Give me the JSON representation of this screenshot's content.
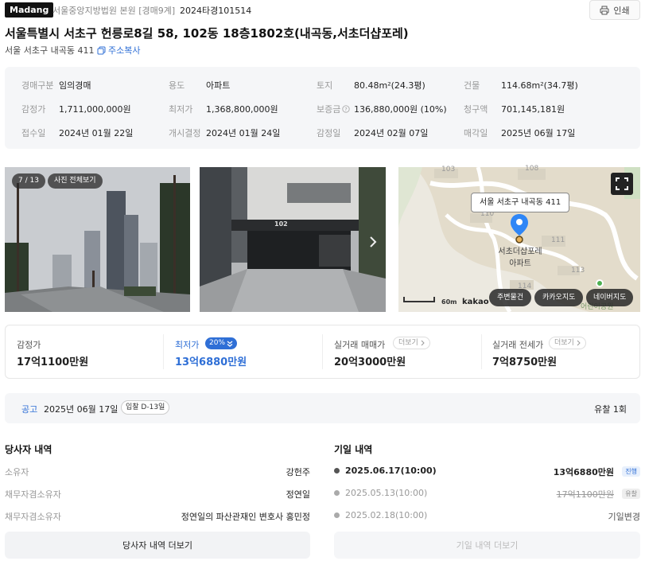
{
  "header": {
    "logo": "Madang",
    "court": "서울중앙지방법원 본원 [경매9계]",
    "case_no": "2024타경101514",
    "print_label": "인쇄"
  },
  "property": {
    "title": "서울특별시 서초구 헌릉로8길 58, 102동 18층1802호(내곡동,서초더샵포레)",
    "sub_address": "서울 서초구 내곡동 411",
    "copy_label": "주소복사"
  },
  "info": {
    "r1": [
      {
        "label": "경매구분",
        "value": "임의경매"
      },
      {
        "label": "용도",
        "value": "아파트"
      },
      {
        "label": "토지",
        "value": "80.48m²(24.3평)"
      },
      {
        "label": "건물",
        "value": "114.68m²(34.7평)"
      }
    ],
    "r2": [
      {
        "label": "감정가",
        "value": "1,711,000,000원"
      },
      {
        "label": "최저가",
        "value": "1,368,800,000원"
      },
      {
        "label": "보증금",
        "value": "136,880,000원 (10%)"
      },
      {
        "label": "청구액",
        "value": "701,145,181원"
      }
    ],
    "r3": [
      {
        "label": "접수일",
        "value": "2024년 01월 22일"
      },
      {
        "label": "개시결정",
        "value": "2024년 01월 24일"
      },
      {
        "label": "감정일",
        "value": "2024년 02월 07일"
      },
      {
        "label": "매각일",
        "value": "2025년 06월 17일"
      }
    ]
  },
  "gallery": {
    "counter": "7 / 13",
    "view_all": "사진 전체보기",
    "building_sign": "102"
  },
  "map": {
    "popup": "서울 서초구 내곡동 411",
    "complex_label_1": "서초더샵포레",
    "complex_label_2": "아파트",
    "bldg_labels": [
      "103",
      "108",
      "110",
      "111",
      "113",
      "114"
    ],
    "park_label": "어린이공원",
    "scale": "60m",
    "brand": "kakao",
    "btn_around": "주변물건",
    "btn_kakao": "카카오지도",
    "btn_naver": "네이버지도"
  },
  "prices": {
    "appraisal": {
      "label": "감정가",
      "value": "17억1100만원"
    },
    "minimum": {
      "label": "최저가",
      "badge": "20%",
      "value": "13억6880만원"
    },
    "sale": {
      "label": "실거래 매매가",
      "more": "더보기",
      "value": "20억3000만원"
    },
    "rent": {
      "label": "실거래 전세가",
      "more": "더보기",
      "value": "7억8750만원"
    }
  },
  "notice": {
    "label": "공고",
    "date": "2025년 06월 17일",
    "dday": "입찰 D-13일",
    "failed": "유찰 1회"
  },
  "parties": {
    "title": "당사자 내역",
    "rows": [
      {
        "role": "소유자",
        "name": "강헌주"
      },
      {
        "role": "채무자겸소유자",
        "name": "정연일"
      },
      {
        "role": "채무자겸소유자",
        "name": "정연일의 파산관재인 변호사 홍민정"
      }
    ],
    "more_button": "당사자 내역 더보기"
  },
  "schedule": {
    "title": "기일 내역",
    "rows": [
      {
        "date": "2025.06.17(10:00)",
        "value": "13억6880만원",
        "tag": "진행"
      },
      {
        "date": "2025.05.13(10:00)",
        "value": "17억1100만원",
        "tag": "유찰"
      },
      {
        "date": "2025.02.18(10:00)",
        "value": "기일변경",
        "tag": ""
      }
    ],
    "more_button": "기일 내역 더보기"
  },
  "colors": {
    "accent": "#2f6fd6",
    "muted": "#999999",
    "panel": "#f5f6f8"
  }
}
